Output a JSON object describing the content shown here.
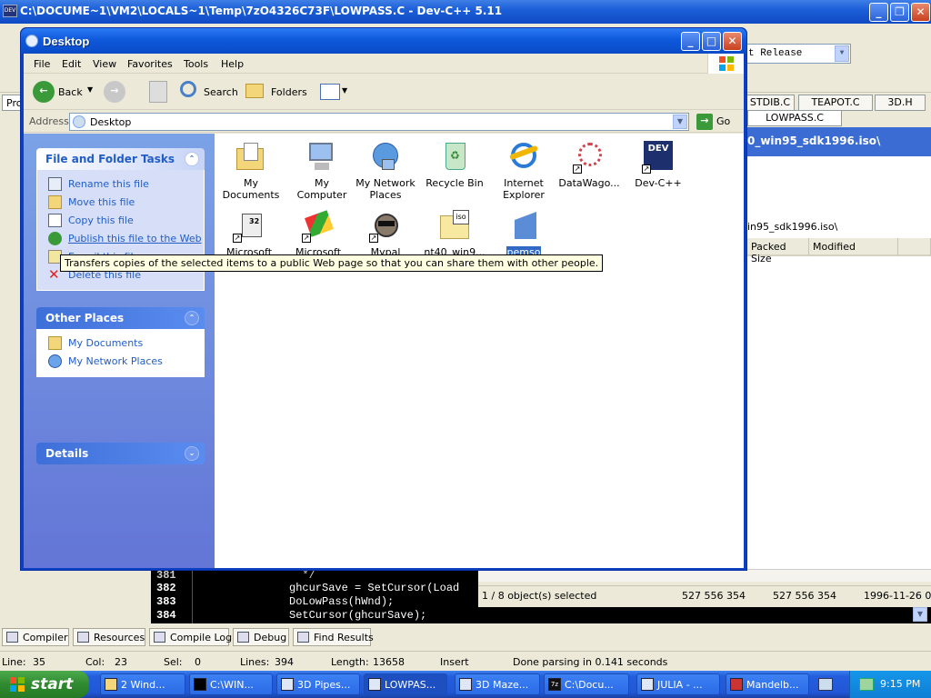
{
  "background_window": {
    "title": "C:\\DOCUME~1\\VM2\\LOCALS~1\\Temp\\7zO4326C73F\\LOWPASS.C - Dev-C++ 5.11",
    "release_select": "t Release",
    "file_tabs": [
      "STDIB.C",
      "TEAPOT.C",
      "3D.H",
      "LOWPASS.C"
    ],
    "side_tab": "Pro",
    "archive_path": "0_win95_sdk1996.iso\\",
    "archive_address": "in95_sdk1996.iso\\",
    "archive_columns": [
      "Packed Size",
      "Modified"
    ],
    "archive_status": {
      "selected": "1 / 8 object(s) selected",
      "size": "527 556 354",
      "packed": "527 556 354",
      "modified": "1996-11-26 08:"
    },
    "code_lines": [
      {
        "num": "381",
        "text": "  */"
      },
      {
        "num": "382",
        "text": "ghcurSave = SetCursor(Load"
      },
      {
        "num": "383",
        "text": "DoLowPass(hWnd);"
      },
      {
        "num": "384",
        "text": "SetCursor(ghcurSave);"
      }
    ],
    "bottom_tabs": [
      "Compiler",
      "Resources",
      "Compile Log",
      "Debug",
      "Find Results"
    ],
    "status": {
      "line_label": "Line:",
      "line_value": "35",
      "col_label": "Col:",
      "col_value": "23",
      "sel_label": "Sel:",
      "sel_value": "0",
      "lines_label": "Lines:",
      "lines_value": "394",
      "length_label": "Length:",
      "length_value": "13658",
      "mode": "Insert",
      "message": "Done parsing in 0.141 seconds"
    }
  },
  "explorer": {
    "title": "Desktop",
    "menu": [
      "File",
      "Edit",
      "View",
      "Favorites",
      "Tools",
      "Help"
    ],
    "toolbar": {
      "back": "Back",
      "search": "Search",
      "folders": "Folders"
    },
    "address_label": "Address",
    "address_value": "Desktop",
    "go_label": "Go",
    "file_tasks": {
      "title": "File and Folder Tasks",
      "items": [
        "Rename this file",
        "Move this file",
        "Copy this file",
        "Publish this file to the Web",
        "E-mail this file",
        "Delete this file"
      ]
    },
    "other_places": {
      "title": "Other Places",
      "items": [
        "My Documents",
        "My Network Places"
      ]
    },
    "details": {
      "title": "Details"
    },
    "tooltip": "Transfers copies of the selected items to a public Web page so that you can share them with other people.",
    "icons_row1": [
      "My Documents",
      "My Computer",
      "My Network Places",
      "Recycle Bin",
      "Internet Explorer",
      "DataWago...",
      "Dev-C++"
    ],
    "icons_row2": [
      "Microsoft Visual C...",
      "Microsoft Visual C...",
      "Mypal",
      "nt40_win9...",
      "pemso"
    ],
    "iso_badge": "iso",
    "devcpp_badge": "DEV"
  },
  "taskbar": {
    "start": "start",
    "buttons": [
      "2 Wind...",
      "C:\\WIN...",
      "3D Pipes...",
      "LOWPAS...",
      "3D Maze...",
      "C:\\Docu...",
      "JULIA - ...",
      "Mandelb..."
    ],
    "clock": "9:15 PM"
  },
  "colors": {
    "xp_blue": "#0a4bc7",
    "task_pane": "#6375d6",
    "selection": "#316ac5",
    "start_green": "#2f8a2f"
  }
}
